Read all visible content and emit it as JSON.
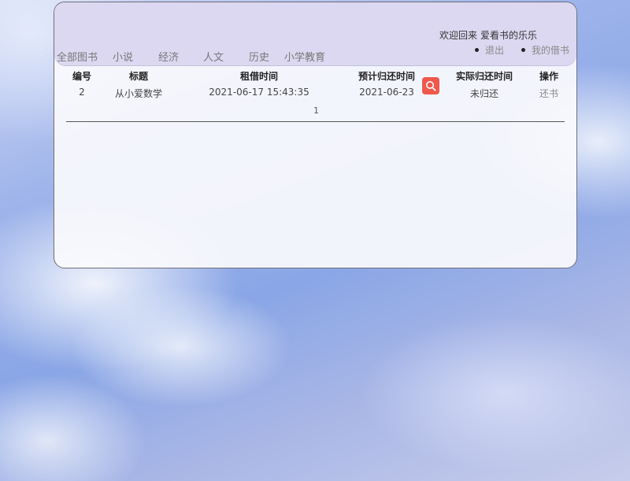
{
  "header": {
    "welcome": "欢迎回来",
    "username": "爱看书的乐乐",
    "links": [
      "退出",
      "我的借书"
    ]
  },
  "nav": {
    "items": [
      "全部图书",
      "小说",
      "经济",
      "人文",
      "历史",
      "小学教育"
    ]
  },
  "table": {
    "columns": [
      "编号",
      "标题",
      "租借时间",
      "预计归还时间",
      "实际归还时间",
      "操作"
    ],
    "rows": [
      {
        "id": "2",
        "title": "从小爱数学",
        "borrow_time": "2021-06-17 15:43:35",
        "due_date": "2021-06-23",
        "return_time": "未归还",
        "action": "还书"
      }
    ]
  },
  "pagination": {
    "current_page": "1"
  },
  "icons": {
    "search": "search-icon"
  },
  "colors": {
    "search_button": "#f0584c",
    "header_bg": "#d7d2ee"
  }
}
